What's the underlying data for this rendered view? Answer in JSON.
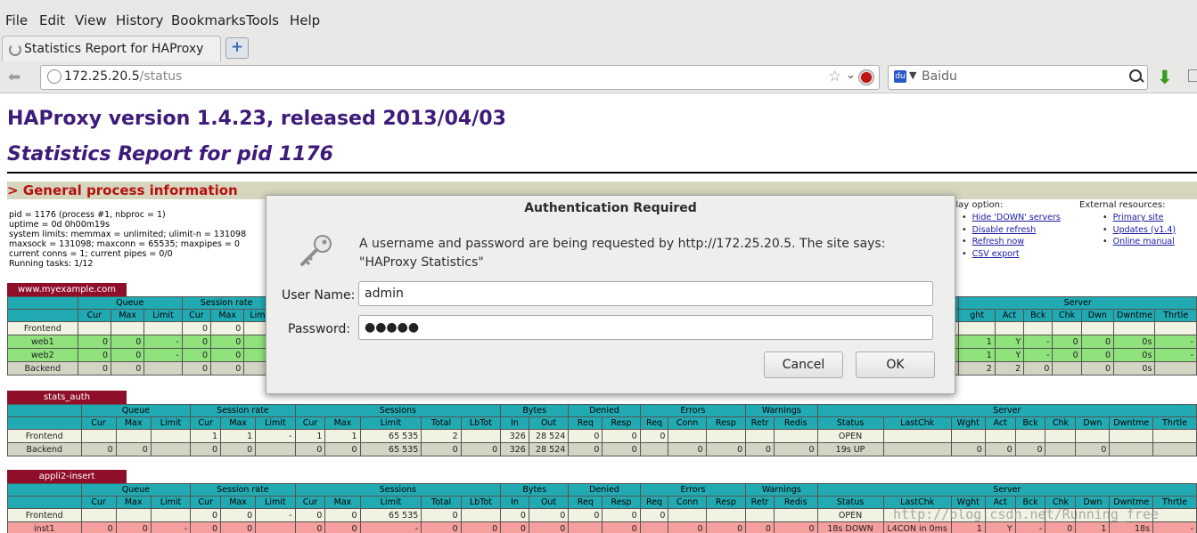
{
  "menu": [
    "File",
    "Edit",
    "View",
    "History",
    "Bookmarks",
    "Tools",
    "Help"
  ],
  "tab": {
    "title": "Statistics Report for HAProxy",
    "new_tab": "+"
  },
  "nav": {
    "url_host": "172.25.20.5",
    "url_path": "/status",
    "search_engine": "Baidu"
  },
  "page": {
    "title": "HAProxy version 1.4.23, released 2013/04/03",
    "subtitle": "Statistics Report for pid 1176",
    "section": "> General process information",
    "process_info": [
      "pid = 1176 (process #1, nbproc = 1)",
      "uptime = 0d 0h00m19s",
      "system limits: memmax = unlimited; ulimit-n = 131098",
      "maxsock = 131098; maxconn = 65535; maxpipes = 0",
      "current conns = 1; current pipes = 0/0",
      "Running tasks: 1/12"
    ],
    "display_title": "play option:",
    "display_options": [
      "Hide 'DOWN' servers",
      "Disable refresh",
      "Refresh now",
      "CSV export"
    ],
    "external_title": "External resources:",
    "external_links": [
      "Primary site",
      "Updates (v1.4)",
      "Online manual"
    ]
  },
  "proxy1": {
    "name": "www.myexample.com",
    "left_groups": [
      "",
      "Queue",
      "Session rate"
    ],
    "left_cols": [
      "",
      "Cur",
      "Max",
      "Limit",
      "Cur",
      "Max",
      "Lim"
    ],
    "left_rows": [
      [
        "Frontend",
        "",
        "",
        "",
        "0",
        "0",
        ""
      ],
      [
        "web1",
        "0",
        "0",
        "-",
        "0",
        "0",
        ""
      ],
      [
        "web2",
        "0",
        "0",
        "-",
        "0",
        "0",
        ""
      ],
      [
        "Backend",
        "0",
        "0",
        "",
        "0",
        "0",
        ""
      ]
    ],
    "right_group": "Server",
    "right_cols": [
      "ght",
      "Act",
      "Bck",
      "Chk",
      "Dwn",
      "Dwntme",
      "Thrtle"
    ],
    "right_rows": [
      [
        "",
        "",
        "",
        "",
        "",
        "",
        ""
      ],
      [
        "1",
        "Y",
        "-",
        "0",
        "0",
        "0s",
        "-"
      ],
      [
        "1",
        "Y",
        "-",
        "0",
        "0",
        "0s",
        "-"
      ],
      [
        "2",
        "2",
        "0",
        "",
        "0",
        "0s",
        ""
      ]
    ]
  },
  "proxy2": {
    "name": "stats_auth",
    "groups": [
      "",
      "Queue",
      "Session rate",
      "Sessions",
      "Bytes",
      "Denied",
      "Errors",
      "Warnings",
      "Server"
    ],
    "cols": [
      "",
      "Cur",
      "Max",
      "Limit",
      "Cur",
      "Max",
      "Limit",
      "Cur",
      "Max",
      "Limit",
      "Total",
      "LbTot",
      "In",
      "Out",
      "Req",
      "Resp",
      "Req",
      "Conn",
      "Resp",
      "Retr",
      "Redis",
      "Status",
      "LastChk",
      "Wght",
      "Act",
      "Bck",
      "Chk",
      "Dwn",
      "Dwntme",
      "Thrtle"
    ],
    "rows": [
      [
        "Frontend",
        "",
        "",
        "",
        "1",
        "1",
        "-",
        "1",
        "1",
        "65 535",
        "2",
        "",
        "326",
        "28 524",
        "0",
        "0",
        "0",
        "",
        "",
        "",
        "",
        "OPEN",
        "",
        "",
        "",
        "",
        "",
        "",
        "",
        ""
      ],
      [
        "Backend",
        "0",
        "0",
        "",
        "0",
        "0",
        "",
        "0",
        "0",
        "65 535",
        "0",
        "0",
        "326",
        "28 524",
        "0",
        "0",
        "",
        "0",
        "0",
        "0",
        "0",
        "19s UP",
        "",
        "0",
        "0",
        "0",
        "",
        "0",
        "",
        ""
      ]
    ]
  },
  "proxy3": {
    "name": "appli2-insert",
    "groups": [
      "",
      "Queue",
      "Session rate",
      "Sessions",
      "Bytes",
      "Denied",
      "Errors",
      "Warnings",
      "Server"
    ],
    "cols": [
      "",
      "Cur",
      "Max",
      "Limit",
      "Cur",
      "Max",
      "Limit",
      "Cur",
      "Max",
      "Limit",
      "Total",
      "LbTot",
      "In",
      "Out",
      "Req",
      "Resp",
      "Req",
      "Conn",
      "Resp",
      "Retr",
      "Redis",
      "Status",
      "LastChk",
      "Wght",
      "Act",
      "Bck",
      "Chk",
      "Dwn",
      "Dwntme",
      "Thrtle"
    ],
    "rows": [
      [
        "Frontend",
        "",
        "",
        "",
        "0",
        "0",
        "-",
        "0",
        "0",
        "65 535",
        "0",
        "",
        "0",
        "0",
        "0",
        "0",
        "0",
        "",
        "",
        "",
        "",
        "OPEN",
        "",
        "",
        "",
        "",
        "",
        "",
        "",
        ""
      ],
      [
        "inst1",
        "0",
        "0",
        "-",
        "0",
        "0",
        "",
        "0",
        "0",
        "-",
        "0",
        "0",
        "0",
        "0",
        "",
        "0",
        "",
        "0",
        "0",
        "0",
        "0",
        "18s DOWN",
        "L4CON in 0ms",
        "1",
        "Y",
        "-",
        "0",
        "1",
        "18s",
        "-"
      ]
    ]
  },
  "watermark": "http://blog.csdn.net/Running_free",
  "dialog": {
    "title": "Authentication Required",
    "message": "A username and password are being requested by http://172.25.20.5. The site says: \"HAProxy Statistics\"",
    "user_label": "User Name:",
    "user_value": "admin",
    "pass_label": "Password:",
    "pass_value": "●●●●●",
    "cancel": "Cancel",
    "ok": "OK"
  },
  "colors": {
    "title": "#3e1a7a",
    "section": "#b5110e",
    "proxy_header": "#8f0f2b",
    "table_header": "#22aab3",
    "up": "#8fe27c",
    "down": "#f59f9f"
  }
}
